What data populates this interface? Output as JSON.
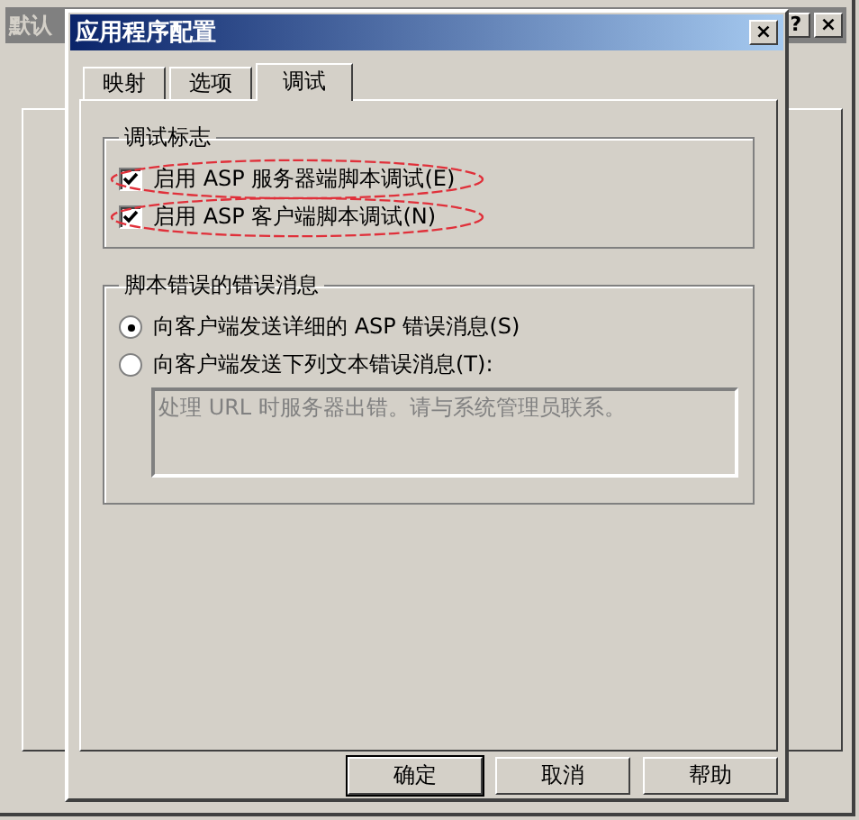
{
  "background_window": {
    "title": "默认",
    "title_buttons": [
      "?",
      "×"
    ]
  },
  "dialog": {
    "title": "应用程序配置",
    "close": "×",
    "tabs": [
      {
        "label": "映射",
        "selected": false
      },
      {
        "label": "选项",
        "selected": false
      },
      {
        "label": "调试",
        "selected": true
      }
    ],
    "debug_flags": {
      "title": "调试标志",
      "options": [
        {
          "label": "启用 ASP 服务器端脚本调试(E)",
          "checked": true,
          "circled": true
        },
        {
          "label": "启用 ASP 客户端脚本调试(N)",
          "checked": true,
          "circled": true
        }
      ]
    },
    "script_errors": {
      "title": "脚本错误的错误消息",
      "options": [
        {
          "label": "向客户端发送详细的 ASP 错误消息(S)",
          "selected": true
        },
        {
          "label": "向客户端发送下列文本错误消息(T):",
          "selected": false
        }
      ],
      "message": {
        "value": "处理 URL 时服务器出错。请与系统管理员联系。",
        "disabled": true
      }
    },
    "buttons": [
      {
        "label": "确定",
        "default": true
      },
      {
        "label": "取消",
        "default": false
      },
      {
        "label": "帮助",
        "default": false
      }
    ]
  }
}
